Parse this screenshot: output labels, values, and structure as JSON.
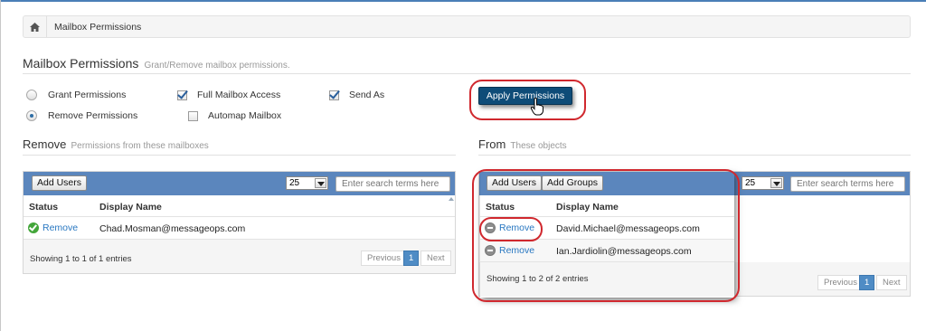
{
  "breadcrumb": {
    "home_icon": "home-icon",
    "current": "Mailbox Permissions"
  },
  "header": {
    "title": "Mailbox Permissions",
    "subtitle": "Grant/Remove mailbox permissions."
  },
  "options": {
    "grant": {
      "label": "Grant Permissions",
      "checked": false
    },
    "remove": {
      "label": "Remove Permissions",
      "checked": true
    },
    "full_access": {
      "label": "Full Mailbox Access",
      "checked": true
    },
    "automap": {
      "label": "Automap Mailbox",
      "checked": false
    },
    "send_as": {
      "label": "Send As",
      "checked": true
    }
  },
  "apply_button": "Apply Permissions",
  "remove_section": {
    "title": "Remove",
    "subtitle": "Permissions from these mailboxes",
    "add_users": "Add Users",
    "page_size": "25",
    "search_placeholder": "Enter search terms here",
    "columns": [
      "Status",
      "Display Name"
    ],
    "rows": [
      {
        "status": "Remove",
        "status_icon": "check-circle-icon",
        "name": "Chad.Mosman@messageops.com"
      }
    ],
    "info": "Showing 1 to 1 of 1 entries",
    "pager": {
      "previous": "Previous",
      "page": "1",
      "next": "Next"
    }
  },
  "from_section": {
    "title": "From",
    "subtitle": "These objects",
    "add_users": "Add Users",
    "add_groups": "Add Groups",
    "page_size": "25",
    "search_placeholder": "Enter search terms here",
    "columns": [
      "Status",
      "Display Name"
    ],
    "rows": [
      {
        "status": "Remove",
        "status_icon": "minus-circle-icon",
        "name": "David.Michael@messageops.com"
      },
      {
        "status": "Remove",
        "status_icon": "minus-circle-icon",
        "name": "Ian.Jardiolin@messageops.com"
      }
    ],
    "info": "Showing 1 to 2 of 2 entries",
    "pager": {
      "previous": "Previous",
      "page": "1",
      "next": "Next"
    }
  },
  "colors": {
    "toolbar": "#5b86bd",
    "apply_button": "#0e4c78",
    "highlight": "#d0282e",
    "link": "#2877c1",
    "active_page": "#4f8cc5"
  }
}
